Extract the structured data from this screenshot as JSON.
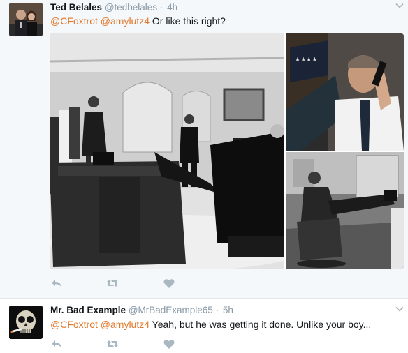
{
  "tweets": [
    {
      "name": "Ted Belales",
      "handle": "@tedbelales",
      "separator": "·",
      "time": "4h",
      "mentions": [
        "@CFoxtrot",
        "@amylutz4"
      ],
      "text": "Or like this right?"
    },
    {
      "name": "Mr. Bad Example",
      "handle": "@MrBadExample65",
      "separator": "·",
      "time": "5h",
      "mentions": [
        "@CFoxtrot",
        "@amylutz4"
      ],
      "text": "Yeah, but he was getting it done. Unlike your boy..."
    }
  ],
  "icons": [
    "reply-icon",
    "retweet-icon",
    "like-icon",
    "chevron-down-icon"
  ],
  "colors": {
    "mention": "#e0782b",
    "muted": "#8899a6",
    "icon": "#aab8c2",
    "tweet_highlight_bg": "#f5f8fa"
  }
}
